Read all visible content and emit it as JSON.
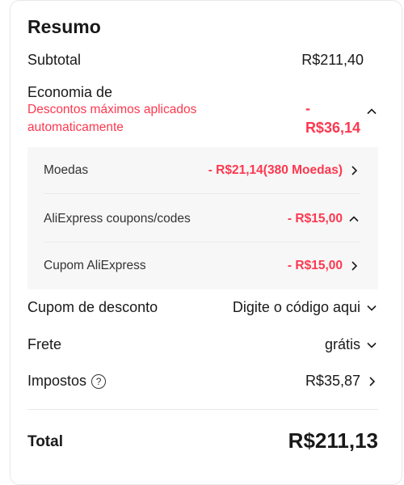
{
  "summary": {
    "title": "Resumo",
    "subtotal_label": "Subtotal",
    "subtotal_value": "R$211,40",
    "savings_label": "Economia de",
    "savings_note_1": "Descontos máximos aplicados",
    "savings_note_2": "automaticamente",
    "savings_amount_sign": "-",
    "savings_amount": "R$36,14",
    "breakdown": [
      {
        "label": "Moedas",
        "value": "- R$21,14(380 Moedas)",
        "icon": "chevron-right-icon"
      },
      {
        "label": "AliExpress coupons/codes",
        "value": "- R$15,00",
        "icon": "chevron-up-icon"
      },
      {
        "label": "Cupom AliExpress",
        "value": "- R$15,00",
        "icon": "chevron-right-icon"
      }
    ],
    "coupon_label": "Cupom de desconto",
    "coupon_placeholder": "Digite o código aqui",
    "shipping_label": "Frete",
    "shipping_value": "grátis",
    "tax_label": "Impostos",
    "tax_help": "?",
    "tax_value": "R$35,87",
    "total_label": "Total",
    "total_value": "R$211,13"
  },
  "colors": {
    "accent": "#fd384f",
    "text": "#191919",
    "panel": "#f7f7f7"
  }
}
